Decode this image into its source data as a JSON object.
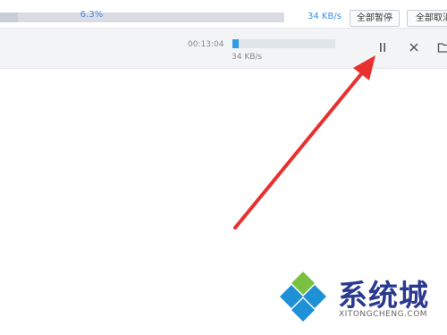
{
  "top_bar": {
    "total_percent_label": "6.3%",
    "total_progress": 0.063,
    "total_speed": "34 KB/s",
    "pause_all_label": "全部暂停",
    "cancel_all_label": "全部取消"
  },
  "task": {
    "elapsed": "00:13:04",
    "progress": 0.063,
    "speed": "34 KB/s",
    "actions": [
      "pause-icon",
      "close-icon",
      "folder-icon"
    ]
  },
  "annotation": {
    "arrow_color": "#e8312f"
  },
  "watermark": {
    "title": "系统城",
    "subtitle": "XITONGCHENG.COM"
  },
  "colors": {
    "accent_blue": "#2f9be8",
    "row_bg": "#f3f4f6"
  }
}
